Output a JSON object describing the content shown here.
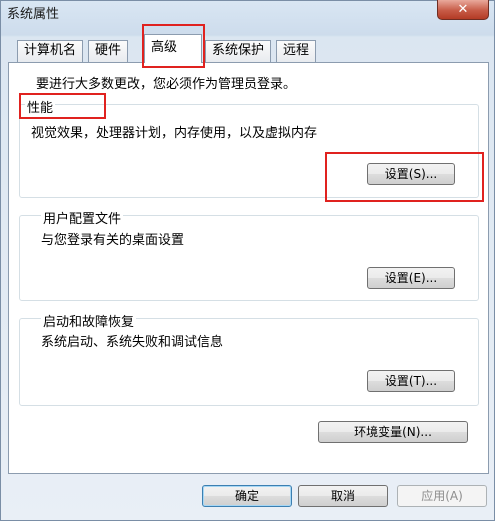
{
  "window": {
    "title": "系统属性",
    "close_label": "✕"
  },
  "tabs": [
    {
      "label": "计算机名"
    },
    {
      "label": "硬件"
    },
    {
      "label": "高级",
      "active": true
    },
    {
      "label": "系统保护"
    },
    {
      "label": "远程"
    }
  ],
  "admin_notice": "要进行大多数更改，您必须作为管理员登录。",
  "groups": {
    "performance": {
      "title": "性能",
      "desc": "视觉效果，处理器计划，内存使用，以及虚拟内存",
      "button": "设置(S)..."
    },
    "user_profiles": {
      "title": "用户配置文件",
      "desc": "与您登录有关的桌面设置",
      "button": "设置(E)..."
    },
    "startup_recovery": {
      "title": "启动和故障恢复",
      "desc": "系统启动、系统失败和调试信息",
      "button": "设置(T)..."
    }
  },
  "env_button": "环境变量(N)...",
  "footer": {
    "ok": "确定",
    "cancel": "取消",
    "apply": "应用(A)"
  },
  "colors": {
    "highlight": "#e0221f",
    "window_frame": "#cddcec"
  }
}
